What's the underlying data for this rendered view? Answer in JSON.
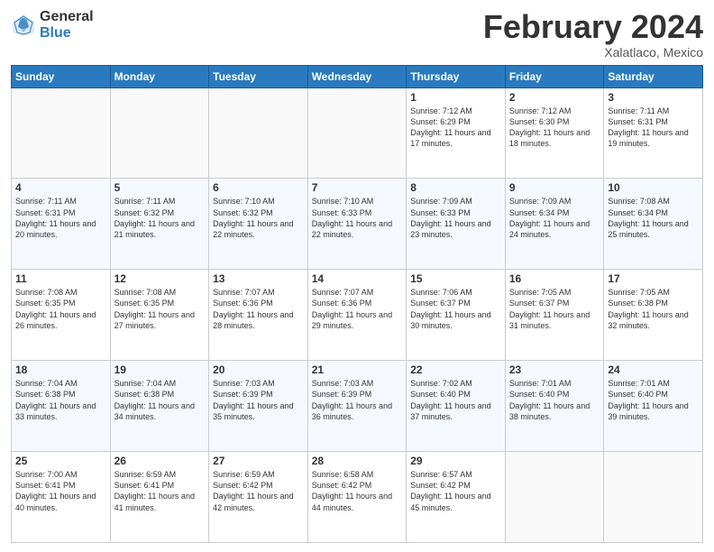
{
  "logo": {
    "general": "General",
    "blue": "Blue"
  },
  "title": "February 2024",
  "subtitle": "Xalatlaco, Mexico",
  "days_header": [
    "Sunday",
    "Monday",
    "Tuesday",
    "Wednesday",
    "Thursday",
    "Friday",
    "Saturday"
  ],
  "weeks": [
    [
      {
        "day": "",
        "info": ""
      },
      {
        "day": "",
        "info": ""
      },
      {
        "day": "",
        "info": ""
      },
      {
        "day": "",
        "info": ""
      },
      {
        "day": "1",
        "info": "Sunrise: 7:12 AM\nSunset: 6:29 PM\nDaylight: 11 hours and 17 minutes."
      },
      {
        "day": "2",
        "info": "Sunrise: 7:12 AM\nSunset: 6:30 PM\nDaylight: 11 hours and 18 minutes."
      },
      {
        "day": "3",
        "info": "Sunrise: 7:11 AM\nSunset: 6:31 PM\nDaylight: 11 hours and 19 minutes."
      }
    ],
    [
      {
        "day": "4",
        "info": "Sunrise: 7:11 AM\nSunset: 6:31 PM\nDaylight: 11 hours and 20 minutes."
      },
      {
        "day": "5",
        "info": "Sunrise: 7:11 AM\nSunset: 6:32 PM\nDaylight: 11 hours and 21 minutes."
      },
      {
        "day": "6",
        "info": "Sunrise: 7:10 AM\nSunset: 6:32 PM\nDaylight: 11 hours and 22 minutes."
      },
      {
        "day": "7",
        "info": "Sunrise: 7:10 AM\nSunset: 6:33 PM\nDaylight: 11 hours and 22 minutes."
      },
      {
        "day": "8",
        "info": "Sunrise: 7:09 AM\nSunset: 6:33 PM\nDaylight: 11 hours and 23 minutes."
      },
      {
        "day": "9",
        "info": "Sunrise: 7:09 AM\nSunset: 6:34 PM\nDaylight: 11 hours and 24 minutes."
      },
      {
        "day": "10",
        "info": "Sunrise: 7:08 AM\nSunset: 6:34 PM\nDaylight: 11 hours and 25 minutes."
      }
    ],
    [
      {
        "day": "11",
        "info": "Sunrise: 7:08 AM\nSunset: 6:35 PM\nDaylight: 11 hours and 26 minutes."
      },
      {
        "day": "12",
        "info": "Sunrise: 7:08 AM\nSunset: 6:35 PM\nDaylight: 11 hours and 27 minutes."
      },
      {
        "day": "13",
        "info": "Sunrise: 7:07 AM\nSunset: 6:36 PM\nDaylight: 11 hours and 28 minutes."
      },
      {
        "day": "14",
        "info": "Sunrise: 7:07 AM\nSunset: 6:36 PM\nDaylight: 11 hours and 29 minutes."
      },
      {
        "day": "15",
        "info": "Sunrise: 7:06 AM\nSunset: 6:37 PM\nDaylight: 11 hours and 30 minutes."
      },
      {
        "day": "16",
        "info": "Sunrise: 7:05 AM\nSunset: 6:37 PM\nDaylight: 11 hours and 31 minutes."
      },
      {
        "day": "17",
        "info": "Sunrise: 7:05 AM\nSunset: 6:38 PM\nDaylight: 11 hours and 32 minutes."
      }
    ],
    [
      {
        "day": "18",
        "info": "Sunrise: 7:04 AM\nSunset: 6:38 PM\nDaylight: 11 hours and 33 minutes."
      },
      {
        "day": "19",
        "info": "Sunrise: 7:04 AM\nSunset: 6:38 PM\nDaylight: 11 hours and 34 minutes."
      },
      {
        "day": "20",
        "info": "Sunrise: 7:03 AM\nSunset: 6:39 PM\nDaylight: 11 hours and 35 minutes."
      },
      {
        "day": "21",
        "info": "Sunrise: 7:03 AM\nSunset: 6:39 PM\nDaylight: 11 hours and 36 minutes."
      },
      {
        "day": "22",
        "info": "Sunrise: 7:02 AM\nSunset: 6:40 PM\nDaylight: 11 hours and 37 minutes."
      },
      {
        "day": "23",
        "info": "Sunrise: 7:01 AM\nSunset: 6:40 PM\nDaylight: 11 hours and 38 minutes."
      },
      {
        "day": "24",
        "info": "Sunrise: 7:01 AM\nSunset: 6:40 PM\nDaylight: 11 hours and 39 minutes."
      }
    ],
    [
      {
        "day": "25",
        "info": "Sunrise: 7:00 AM\nSunset: 6:41 PM\nDaylight: 11 hours and 40 minutes."
      },
      {
        "day": "26",
        "info": "Sunrise: 6:59 AM\nSunset: 6:41 PM\nDaylight: 11 hours and 41 minutes."
      },
      {
        "day": "27",
        "info": "Sunrise: 6:59 AM\nSunset: 6:42 PM\nDaylight: 11 hours and 42 minutes."
      },
      {
        "day": "28",
        "info": "Sunrise: 6:58 AM\nSunset: 6:42 PM\nDaylight: 11 hours and 44 minutes."
      },
      {
        "day": "29",
        "info": "Sunrise: 6:57 AM\nSunset: 6:42 PM\nDaylight: 11 hours and 45 minutes."
      },
      {
        "day": "",
        "info": ""
      },
      {
        "day": "",
        "info": ""
      }
    ]
  ]
}
